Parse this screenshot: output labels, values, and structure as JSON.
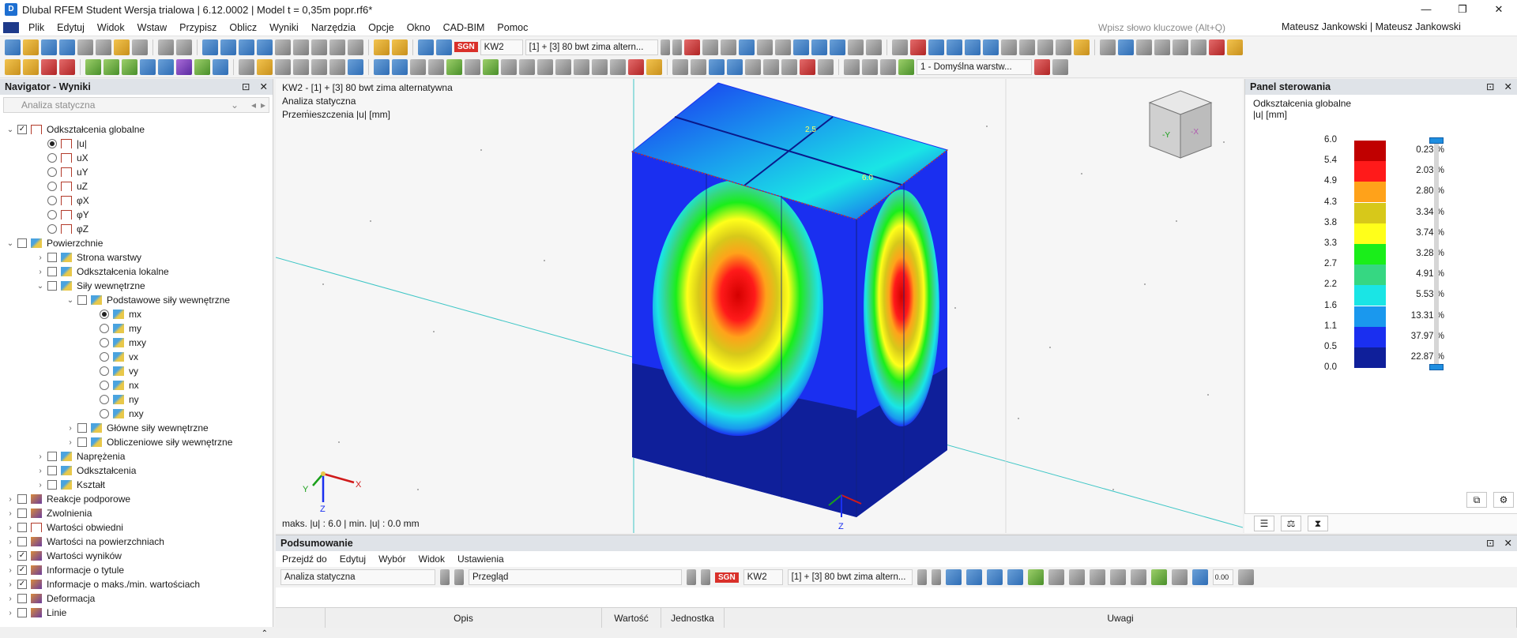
{
  "window": {
    "title": "Dlubal RFEM Student Wersja trialowa | 6.12.0002 | Model t = 0,35m popr.rf6*",
    "buttons": [
      "—",
      "❐",
      "✕"
    ]
  },
  "menu": {
    "items": [
      "Plik",
      "Edytuj",
      "Widok",
      "Wstaw",
      "Przypisz",
      "Oblicz",
      "Wyniki",
      "Narzędzia",
      "Opcje",
      "Okno",
      "CAD-BIM",
      "Pomoc"
    ],
    "search_placeholder": "Wpisz słowo kluczowe (Alt+Q)",
    "user": "Mateusz Jankowski | Mateusz Jankowski"
  },
  "toolbar": {
    "sgn": "SGN",
    "combination": "KW2",
    "load_case": "[1] + [3] 80 bwt zima altern...",
    "layer": "1 - Domyślna warstw..."
  },
  "navigator": {
    "title": "Navigator - Wyniki",
    "analysis": "Analiza statyczna",
    "items": [
      {
        "label": "Odkształcenia globalne",
        "level": 0,
        "toggle": "⌄",
        "control": "cb",
        "checked": true,
        "icon": "def"
      },
      {
        "label": "|u|",
        "level": 1,
        "toggle": "",
        "control": "rb",
        "checked": true,
        "icon": "def"
      },
      {
        "label": "uX",
        "level": 1,
        "toggle": "",
        "control": "rb",
        "checked": false,
        "icon": "def"
      },
      {
        "label": "uY",
        "level": 1,
        "toggle": "",
        "control": "rb",
        "checked": false,
        "icon": "def"
      },
      {
        "label": "uZ",
        "level": 1,
        "toggle": "",
        "control": "rb",
        "checked": false,
        "icon": "def"
      },
      {
        "label": "φX",
        "level": 1,
        "toggle": "",
        "control": "rb",
        "checked": false,
        "icon": "def"
      },
      {
        "label": "φY",
        "level": 1,
        "toggle": "",
        "control": "rb",
        "checked": false,
        "icon": "def"
      },
      {
        "label": "φZ",
        "level": 1,
        "toggle": "",
        "control": "rb",
        "checked": false,
        "icon": "def"
      },
      {
        "label": "Powierzchnie",
        "level": 0,
        "toggle": "⌄",
        "control": "cb",
        "checked": false,
        "icon": "surf"
      },
      {
        "label": "Strona warstwy",
        "level": 1,
        "toggle": "›",
        "control": "cb",
        "checked": false,
        "icon": "surf"
      },
      {
        "label": "Odkształcenia lokalne",
        "level": 1,
        "toggle": "›",
        "control": "cb",
        "checked": false,
        "icon": "surf"
      },
      {
        "label": "Siły wewnętrzne",
        "level": 1,
        "toggle": "⌄",
        "control": "cb",
        "checked": false,
        "icon": "surf"
      },
      {
        "label": "Podstawowe siły wewnętrzne",
        "level": 2,
        "toggle": "⌄",
        "control": "cb",
        "checked": false,
        "icon": "surf"
      },
      {
        "label": "mx",
        "level": 3,
        "toggle": "",
        "control": "rb",
        "checked": true,
        "icon": "surf"
      },
      {
        "label": "my",
        "level": 3,
        "toggle": "",
        "control": "rb",
        "checked": false,
        "icon": "surf"
      },
      {
        "label": "mxy",
        "level": 3,
        "toggle": "",
        "control": "rb",
        "checked": false,
        "icon": "surf"
      },
      {
        "label": "vx",
        "level": 3,
        "toggle": "",
        "control": "rb",
        "checked": false,
        "icon": "surf"
      },
      {
        "label": "vy",
        "level": 3,
        "toggle": "",
        "control": "rb",
        "checked": false,
        "icon": "surf"
      },
      {
        "label": "nx",
        "level": 3,
        "toggle": "",
        "control": "rb",
        "checked": false,
        "icon": "surf"
      },
      {
        "label": "ny",
        "level": 3,
        "toggle": "",
        "control": "rb",
        "checked": false,
        "icon": "surf"
      },
      {
        "label": "nxy",
        "level": 3,
        "toggle": "",
        "control": "rb",
        "checked": false,
        "icon": "surf"
      },
      {
        "label": "Główne siły wewnętrzne",
        "level": 2,
        "toggle": "›",
        "control": "cb",
        "checked": false,
        "icon": "surf"
      },
      {
        "label": "Obliczeniowe siły wewnętrzne",
        "level": 2,
        "toggle": "›",
        "control": "cb",
        "checked": false,
        "icon": "surf"
      },
      {
        "label": "Naprężenia",
        "level": 1,
        "toggle": "›",
        "control": "cb",
        "checked": false,
        "icon": "surf"
      },
      {
        "label": "Odkształcenia",
        "level": 1,
        "toggle": "›",
        "control": "cb",
        "checked": false,
        "icon": "surf"
      },
      {
        "label": "Kształt",
        "level": 1,
        "toggle": "›",
        "control": "cb",
        "checked": false,
        "icon": "surf"
      },
      {
        "label": "Reakcje podporowe",
        "level": 0,
        "toggle": "›",
        "control": "cb",
        "checked": false,
        "icon": "other"
      },
      {
        "label": "Zwolnienia",
        "level": 0,
        "toggle": "›",
        "control": "cb",
        "checked": false,
        "icon": "other"
      },
      {
        "label": "Wartości obwiedni",
        "level": 0,
        "toggle": "›",
        "control": "cb",
        "checked": false,
        "icon": "def"
      },
      {
        "label": "Wartości na powierzchniach",
        "level": 0,
        "toggle": "›",
        "control": "cb",
        "checked": false,
        "icon": "other"
      },
      {
        "label": "Wartości wyników",
        "level": 0,
        "toggle": "›",
        "control": "cb",
        "checked": true,
        "icon": "other"
      },
      {
        "label": "Informacje o tytule",
        "level": 0,
        "toggle": "›",
        "control": "cb",
        "checked": true,
        "icon": "other"
      },
      {
        "label": "Informacje o maks./min. wartościach",
        "level": 0,
        "toggle": "›",
        "control": "cb",
        "checked": true,
        "icon": "other"
      },
      {
        "label": "Deformacja",
        "level": 0,
        "toggle": "›",
        "control": "cb",
        "checked": false,
        "icon": "other"
      },
      {
        "label": "Linie",
        "level": 0,
        "toggle": "›",
        "control": "cb",
        "checked": false,
        "icon": "other"
      }
    ]
  },
  "viewport": {
    "info_lines": [
      "KW2 - [1] + [3] 80 bwt zima alternatywna",
      "Analiza statyczna",
      "Przemieszczenia |u| [mm]"
    ],
    "max_min": "maks. |u| : 6.0 | min. |u| : 0.0 mm",
    "contour_labels": [
      "2.5",
      "6.0"
    ],
    "axis_labels": {
      "x": "X",
      "y": "Y",
      "z": "Z"
    },
    "cube_labels": [
      "-Y",
      "-X"
    ]
  },
  "control_panel": {
    "title": "Panel sterowania",
    "subtitle": "Odkształcenia globalne",
    "unit": "|u| [mm]",
    "legend": [
      {
        "value": "6.0",
        "color": "#c00000",
        "percent": "0.23 %"
      },
      {
        "value": "5.4",
        "color": "#ff1a1a",
        "percent": "2.03 %"
      },
      {
        "value": "4.9",
        "color": "#ffa21a",
        "percent": "2.80 %"
      },
      {
        "value": "4.3",
        "color": "#d7c81a",
        "percent": "3.34 %"
      },
      {
        "value": "3.8",
        "color": "#ffff1a",
        "percent": "3.74 %"
      },
      {
        "value": "3.3",
        "color": "#1aee1a",
        "percent": "3.28 %"
      },
      {
        "value": "2.7",
        "color": "#36d782",
        "percent": "4.91 %"
      },
      {
        "value": "2.2",
        "color": "#1ae5e5",
        "percent": "5.53 %"
      },
      {
        "value": "1.6",
        "color": "#1a98ee",
        "percent": "13.31 %"
      },
      {
        "value": "1.1",
        "color": "#1a2ff0",
        "percent": "37.97 %"
      },
      {
        "value": "0.5",
        "color": "#0f1f9a",
        "percent": "22.87 %"
      },
      {
        "value": "0.0",
        "color": "",
        "percent": ""
      }
    ]
  },
  "summary": {
    "title": "Podsumowanie",
    "menu": [
      "Przejdź do",
      "Edytuj",
      "Wybór",
      "Widok",
      "Ustawienia"
    ],
    "analysis": "Analiza statyczna",
    "view": "Przegląd",
    "sgn": "SGN",
    "combination": "KW2",
    "load_case": "[1] + [3] 80 bwt zima altern...",
    "columns": [
      "",
      "Opis",
      "Wartość",
      "Jednostka",
      "Uwagi"
    ],
    "zero_label": "0.00"
  },
  "colors": {
    "axis_line": "#3fc6c6",
    "accent": "#1e8ee0",
    "sgn_red": "#d9302a"
  }
}
